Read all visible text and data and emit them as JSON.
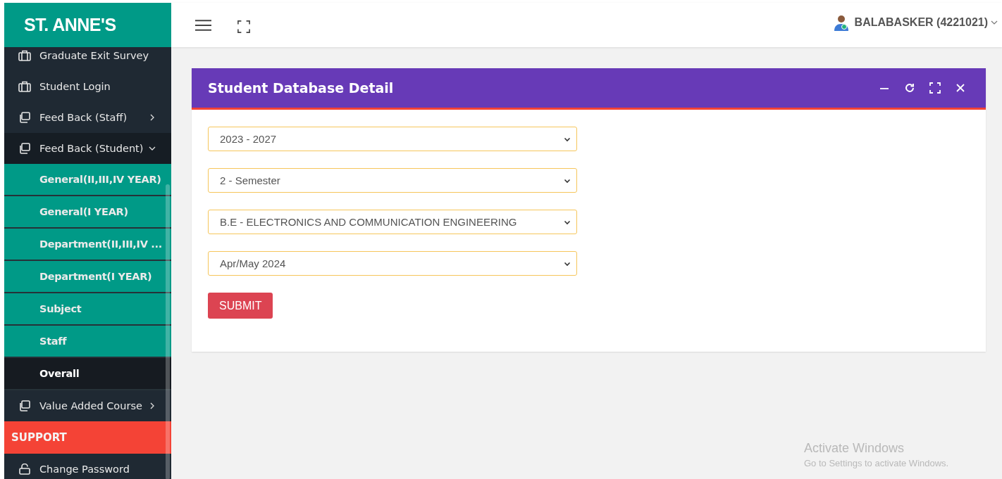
{
  "brand": "ST. ANNE'S",
  "sidebar": {
    "items": [
      {
        "label": "Graduate Exit Survey",
        "kind": "page"
      },
      {
        "label": "Student Login",
        "kind": "page"
      },
      {
        "label": "Feed Back (Staff)",
        "kind": "group",
        "expanded": false
      },
      {
        "label": "Feed Back (Student)",
        "kind": "group",
        "expanded": true,
        "children": [
          {
            "label": "General(II,III,IV YEAR)",
            "selected": false
          },
          {
            "label": "General(I YEAR)",
            "selected": false
          },
          {
            "label": "Department(II,III,IV ...",
            "selected": false
          },
          {
            "label": "Department(I YEAR)",
            "selected": false
          },
          {
            "label": "Subject",
            "selected": false
          },
          {
            "label": "Staff",
            "selected": false
          },
          {
            "label": "Overall",
            "selected": true
          }
        ]
      },
      {
        "label": "Value Added Course",
        "kind": "group",
        "expanded": false
      },
      {
        "label": "SUPPORT",
        "kind": "header"
      },
      {
        "label": "Change Password",
        "kind": "account"
      }
    ]
  },
  "user": {
    "name": "BALABASKER (4221021)"
  },
  "panel": {
    "title": "Student Database Detail",
    "selects": [
      {
        "value": "2023 - 2027"
      },
      {
        "value": "2 - Semester"
      },
      {
        "value": "B.E - ELECTRONICS AND COMMUNICATION ENGINEERING"
      },
      {
        "value": "Apr/May 2024"
      }
    ],
    "submit": "SUBMIT"
  },
  "os_notice": {
    "title": "Activate Windows",
    "subtitle": "Go to Settings to activate Windows."
  }
}
